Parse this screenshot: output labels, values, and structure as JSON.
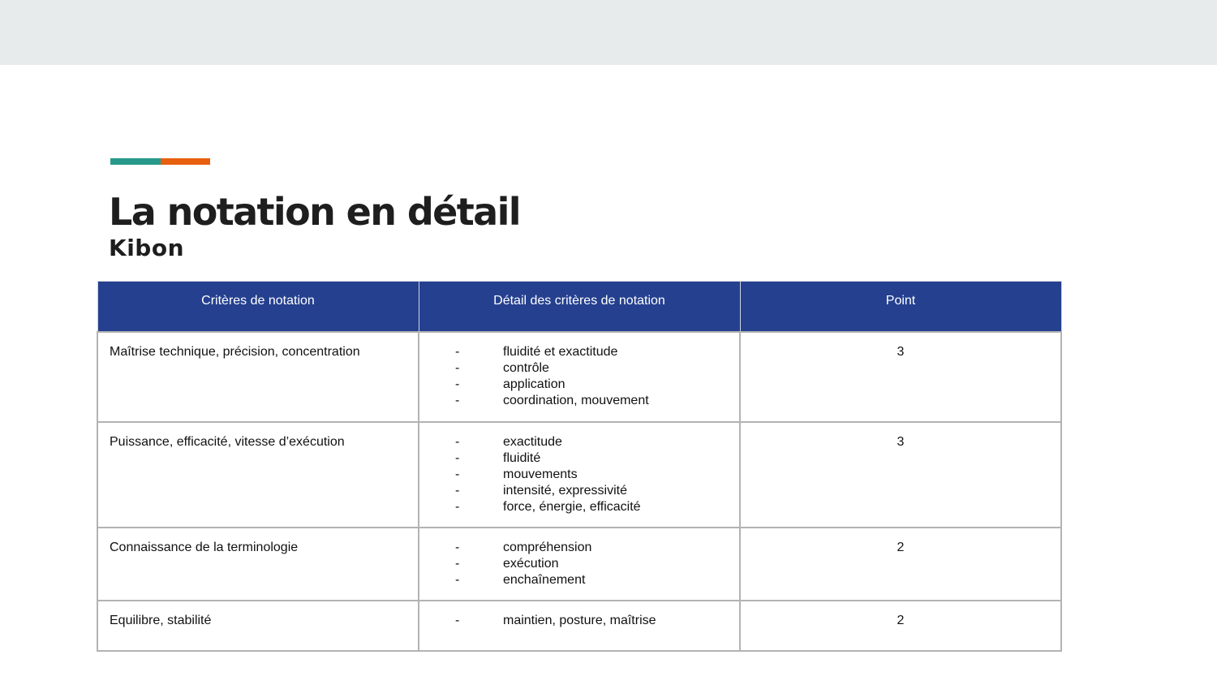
{
  "colors": {
    "top_band": "#e8ebec",
    "accent_teal": "#26998a",
    "accent_orange": "#e8600f",
    "header_blue": "#25408f"
  },
  "slide": {
    "title": "La notation en détail",
    "subtitle": "Kibon"
  },
  "table": {
    "headers": [
      "Critères de notation",
      "Détail des critères de notation",
      "Point"
    ],
    "bullet": "-",
    "rows": [
      {
        "criterion": "Maîtrise technique, précision, concentration",
        "details": [
          "fluidité et exactitude",
          "contrôle",
          "application",
          "coordination, mouvement"
        ],
        "points": "3"
      },
      {
        "criterion": "Puissance, efficacité, vitesse d’exécution",
        "details": [
          "exactitude",
          "fluidité",
          "mouvements",
          "intensité, expressivité",
          "force, énergie, efficacité"
        ],
        "points": "3"
      },
      {
        "criterion": "Connaissance de la terminologie",
        "details": [
          "compréhension",
          "exécution",
          "enchaînement"
        ],
        "points": "2"
      },
      {
        "criterion": "Equilibre, stabilité",
        "details": [
          "maintien, posture, maîtrise"
        ],
        "points": "2"
      }
    ]
  }
}
